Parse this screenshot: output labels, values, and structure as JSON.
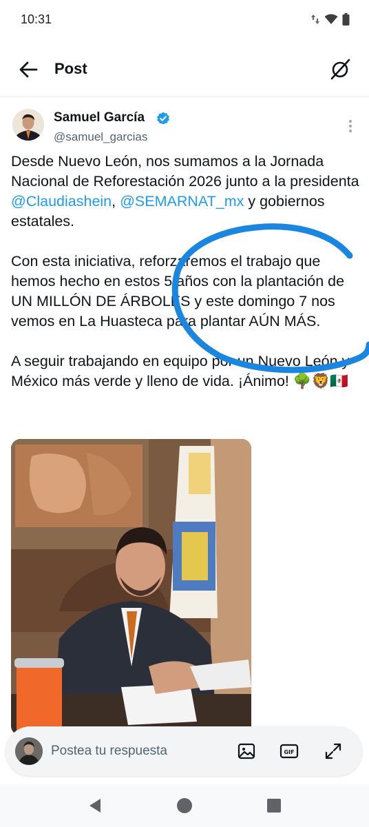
{
  "status_bar": {
    "time": "10:31"
  },
  "header": {
    "title": "Post"
  },
  "author": {
    "name": "Samuel García",
    "handle": "@samuel_garcias"
  },
  "tweet": {
    "p1": [
      {
        "text": "Desde Nuevo León, nos sumamos a la Jornada Nacional de Reforestación 2026 junto a la presidenta "
      },
      {
        "text": "@Claudiashein",
        "mention": true
      },
      {
        "text": ", "
      },
      {
        "text": "@SEMARNAT_mx",
        "mention": true
      },
      {
        "text": " y gobiernos estatales."
      }
    ],
    "p2": "Con esta iniciativa, reforzaremos el trabajo que hemos hecho en estos 5 años con la plantación de UN MILLÓN DE ÁRBOLES y este domingo 7 nos vemos en La Huasteca para plantar AÚN MÁS.",
    "p3": "A seguir trabajando en equipo por un Nuevo León y México más verde y lleno de vida. ¡Ánimo! 🌳🦁🇲🇽"
  },
  "reply": {
    "placeholder": "Postea tu respuesta"
  },
  "colors": {
    "link": "#1d9bf0",
    "annotation": "#1a86e0",
    "verified": "#1d9bf0"
  },
  "icons": [
    "back-arrow-icon",
    "grok-icon",
    "verified-badge-icon",
    "more-icon",
    "image-icon",
    "gif-icon",
    "expand-icon",
    "nav-back-icon",
    "nav-home-icon",
    "nav-recents-icon"
  ]
}
